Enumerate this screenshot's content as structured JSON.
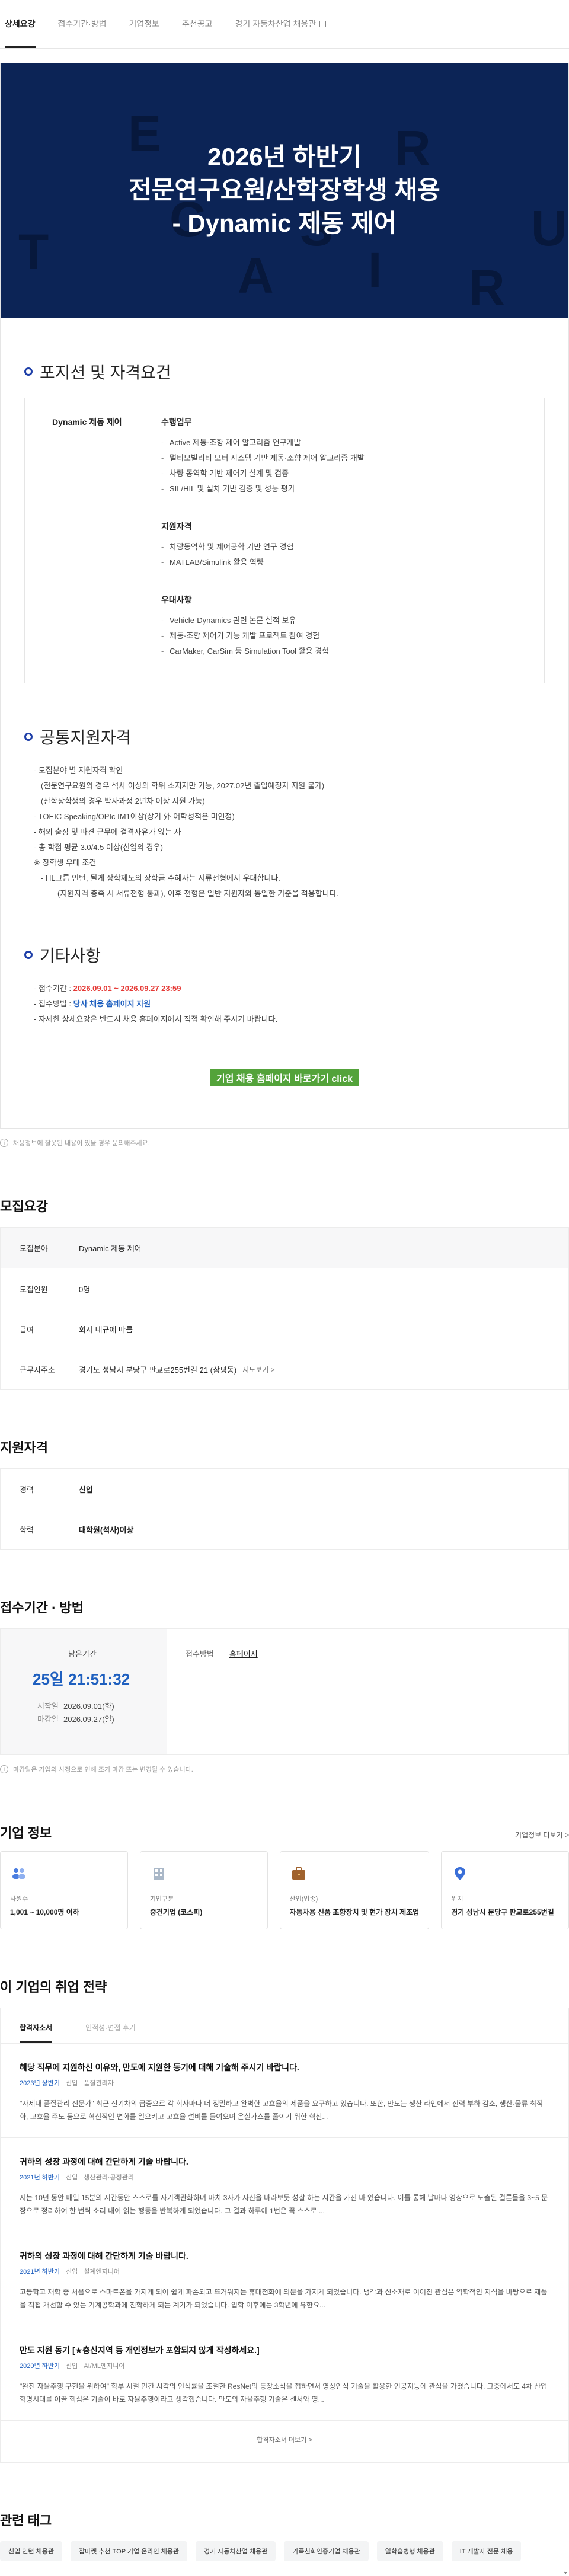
{
  "tabs": [
    {
      "label": "상세요강"
    },
    {
      "label": "접수기간·방법"
    },
    {
      "label": "기업정보"
    },
    {
      "label": "추천공고"
    },
    {
      "label": "경기 자동차산업 채용관"
    }
  ],
  "hero": {
    "title_lines": [
      "2026년 하반기",
      "전문연구요원/산학장학생 채용",
      "- Dynamic 제동 제어"
    ],
    "deco_letters": [
      "E",
      "R",
      "S",
      "U",
      "C",
      "T",
      "I",
      "A",
      "R"
    ]
  },
  "position": {
    "heading": "포지션 및 자격요건",
    "name": "Dynamic 제동 제어",
    "groups": [
      {
        "title": "수행업무",
        "items": [
          "Active 제동·조향 제어 알고리즘 연구개발",
          "멀티모빌리티 모터 시스템 기반 제동·조향 제어 알고리즘 개발",
          "차량 동역학 기반 제어기 설계 및 검증",
          "SIL/HIL 및 실차 기반 검증 및 성능 평가"
        ]
      },
      {
        "title": "지원자격",
        "items": [
          "차량동역학 및 제어공학 기반 연구 경험",
          "MATLAB/Simulink 활용 역량"
        ]
      },
      {
        "title": "우대사항",
        "items": [
          "Vehicle-Dynamics 관련 논문 실적 보유",
          "제동·조향 제어기 기능 개발 프로젝트 참여 경험",
          "CarMaker, CarSim 등 Simulation Tool 활용 경험"
        ]
      }
    ]
  },
  "common": {
    "heading": "공통지원자격",
    "lines": [
      "- 모집분야 별 지원자격 확인",
      "(전문연구요원의 경우 석사 이상의 학위 소지자만 가능, 2027.02년 졸업예정자 지원 불가)",
      "(산학장학생의 경우 박사과정 2년차 이상 지원 가능)",
      "- TOEIC Speaking/OPIc IM1이상(상기 外 어학성적은 미인정)",
      "- 해외 출장 및 파견 근무에 결격사유가 없는 자",
      "- 총 학점 평균 3.0/4.5 이상(신입의 경우)",
      "※ 장학생 우대 조건",
      "- HL그룹 인턴, 될게 장학제도의 장학금 수혜자는 서류전형에서 우대합니다.",
      "(지원자격 충족 시 서류전형 통과), 이후 전형은 일반 지원자와 동일한 기준을 적용합니다."
    ]
  },
  "etc": {
    "heading": "기타사항",
    "period_label": "- 접수기간 : ",
    "period_value": "2026.09.01 ~ 2026.09.27  23:59",
    "method_label": "- 접수방법 : ",
    "method_value": "당사 채용 홈페이지 지원",
    "detail": "- 자세한 상세요강은 반드시 채용 홈페이지에서 직접 확인해 주시기 바랍니다.",
    "cta": "기업 채용 홈페이지 바로가기 click"
  },
  "notice1": "채용정보에 잘못된 내용이 있을 경우 문의해주세요.",
  "recruit": {
    "heading": "모집요강",
    "field_k": "모집분야",
    "field_v": "Dynamic 제동 제어",
    "count_k": "모집인원",
    "count_v": "0명",
    "salary_k": "급여",
    "salary_v": "회사 내규에 따름",
    "addr_k": "근무지주소",
    "addr_v": "경기도 성남시 분당구 판교로255번길 21 (삼평동)",
    "addr_link": "지도보기 >"
  },
  "qual": {
    "heading": "지원자격",
    "exp_k": "경력",
    "exp_v": "신입",
    "edu_k": "학력",
    "edu_v": "대학원(석사)이상"
  },
  "period": {
    "heading": "접수기간 · 방법",
    "remain_label": "남은기간",
    "remain_value": "25일 21:51:32",
    "start_k": "시작일",
    "start_v": "2026.09.01(화)",
    "end_k": "마감일",
    "end_v": "2026.09.27(일)",
    "method_k": "접수방법",
    "method_v": "홈페이지",
    "note": "마감일은 기업의 사정으로 인해 조기 마감 또는 변경될 수 있습니다."
  },
  "corp": {
    "heading": "기업 정보",
    "more": "기업정보 더보기 >",
    "cards": [
      {
        "l1": "사원수",
        "l2": "1,001 ~ 10,000명 이하",
        "icon": "people-icon"
      },
      {
        "l1": "기업구분",
        "l2": "중견기업 (코스피)",
        "icon": "building-icon"
      },
      {
        "l1": "산업(업종)",
        "l2": "자동차용 신품 조향장치 및 현가 장치 제조업",
        "icon": "briefcase-icon"
      },
      {
        "l1": "위치",
        "l2": "경기 성남시 분당구 판교로255번길",
        "icon": "location-icon"
      }
    ]
  },
  "strategy": {
    "heading": "이 기업의 취업 전략",
    "tabs": [
      "합격자소서",
      "인적성·면접 후기"
    ],
    "items": [
      {
        "title": "해당 직무에 지원하신 이유와, 만도에 지원한 동기에 대해 기술해 주시기 바랍니다.",
        "year": "2023년 상반기",
        "sub": "신입",
        "role": "품질관리자",
        "body": "\"자세대 품질관리 전문가\" 최근 전기차의 급증으로 각 회사마다 더 정밀하고 완벽한 고효율의 제품을 요구하고 있습니다. 또한, 만도는 생산 라인에서 전력 부하 감소, 생산·물류 최적화, 고효율 주도 등으로 혁신적인 변화를 일으키고 고효율 설비를 들여오며 온실가스를 줄이기 위한 혁신..."
      },
      {
        "title": "귀하의 성장 과정에 대해 간단하게 기술 바랍니다.",
        "year": "2021년 하반기",
        "sub": "신입",
        "role": "생산관리·공정관리",
        "body": "저는 10년 동안 매일 15분의 시간동안 스스로를 자기객관화하며 마치 3자가 자신을 바라보듯 성찰 하는 시간을 가진 바 있습니다. 이를 통해 날마다 영상으로 도출된 결론들을 3~5 문장으로 정리하여 한 번씩 소리 내어 읽는 행동을 반복하게 되었습니다. 그 결과 하루에 1번은 꼭 스스로 ..."
      },
      {
        "title": "귀하의 성장 과정에 대해 간단하게 기술 바랍니다.",
        "year": "2021년 하반기",
        "sub": "신입",
        "role": "설계엔지니어",
        "body": "고등학교 재학 중 처음으로 스마트폰을 가지게 되어 쉽게 파손되고 뜨거워지는 휴대전화에 의문을 가지게 되었습니다. 냉각과 신소재로 이어진 관심은 역학적인 지식을 바탕으로 제품을 직접 개선할 수 있는 기계공학과에 진학하게 되는 계기가 되었습니다. 입학 이후에는 3학년에 유한요..."
      },
      {
        "title": "만도 지원 동기 [★충신지역 등 개인정보가 포함되지 않게 작성하세요.]",
        "year": "2020년 하반기",
        "sub": "신입",
        "role": "AI/ML엔지니어",
        "body": "\"완전 자율주행 구현을 위하여\" 학부 시절 인간 시각의 인식률을 조절한 ResNet의 등장소식을 접하면서 영상인식 기술을 활용한 인공지능에 관심을 가졌습니다. 그중에서도 4차 산업혁명시대를 이끌 핵심은 기술이 바로 자율주행이라고 생각했습니다. 만도의 자율주행 기술은 센서와 영..."
      }
    ],
    "more": "합격자소서 더보기 >"
  },
  "related": {
    "heading": "관련 태그",
    "tags": [
      "신입 인턴 채용관",
      "잡마켓 추천 TOP 기업 온라인 채용관",
      "경기 자동차산업 채용관",
      "가족친화인증기업 채용관",
      "일학습병행 채용관",
      "IT 개발자 전문 채용"
    ]
  },
  "colors": {
    "hero_bg": "#0c2456",
    "accent": "#1e5fbf",
    "red": "#e53935",
    "cta": "#53a33a"
  }
}
